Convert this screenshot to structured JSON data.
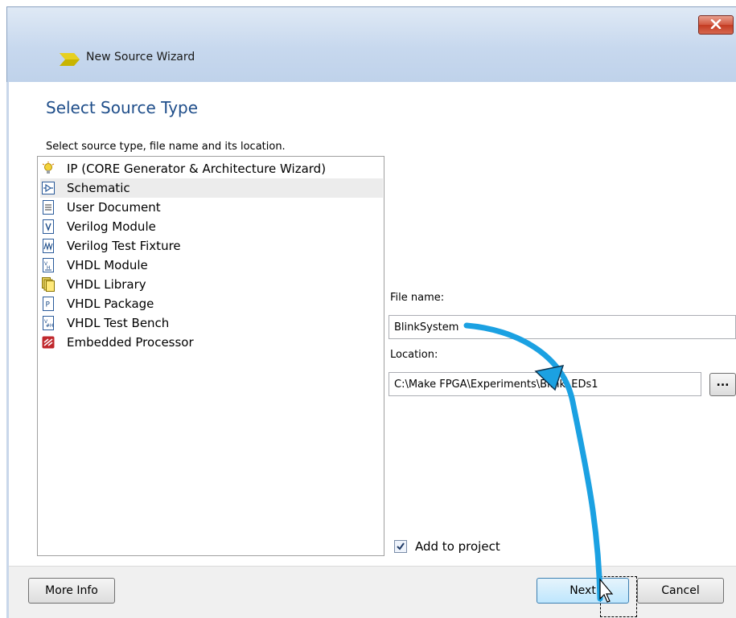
{
  "window": {
    "title": "New Source Wizard"
  },
  "page": {
    "title": "Select Source Type",
    "instruction": "Select source type, file name and its location."
  },
  "source_types": [
    {
      "label": "IP (CORE Generator & Architecture Wizard)",
      "icon": "ip-core-icon"
    },
    {
      "label": "Schematic",
      "icon": "schematic-icon",
      "selected": true
    },
    {
      "label": "User Document",
      "icon": "document-icon"
    },
    {
      "label": "Verilog Module",
      "icon": "verilog-module-icon"
    },
    {
      "label": "Verilog Test Fixture",
      "icon": "verilog-test-fixture-icon"
    },
    {
      "label": "VHDL Module",
      "icon": "vhdl-module-icon"
    },
    {
      "label": "VHDL Library",
      "icon": "vhdl-library-icon"
    },
    {
      "label": "VHDL Package",
      "icon": "vhdl-package-icon"
    },
    {
      "label": "VHDL Test Bench",
      "icon": "vhdl-test-bench-icon"
    },
    {
      "label": "Embedded Processor",
      "icon": "embedded-processor-icon"
    }
  ],
  "file_name": {
    "label": "File name:",
    "value": "BlinkSystem"
  },
  "location": {
    "label": "Location:",
    "value": "C:\\Make FPGA\\Experiments\\BlinkLEDs1",
    "browse_label": "..."
  },
  "add_to_project": {
    "label": "Add to project",
    "checked": true
  },
  "buttons": {
    "more_info": "More Info",
    "next": "Next",
    "cancel": "Cancel"
  },
  "colors": {
    "title_blue": "#1f4e8a",
    "annotation_arrow": "#1ba1e2",
    "close_red": "#c43b22"
  }
}
